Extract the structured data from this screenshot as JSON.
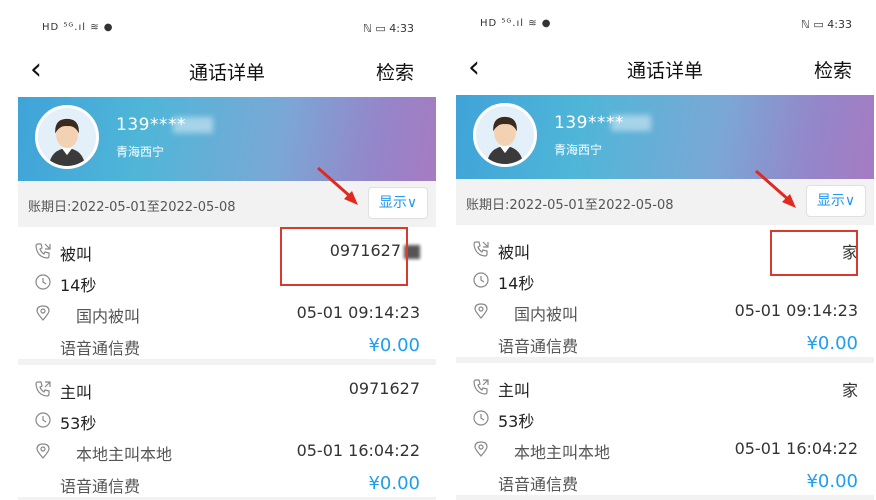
{
  "status_bar": {
    "left": "HD ⁵ᴳ.ıl ≋ ●",
    "right": "ℕ ▭ 4:33"
  },
  "nav": {
    "back_glyph": "‹",
    "title": "通话详单",
    "search": "检索"
  },
  "profile": {
    "number": "139****",
    "region": "青海西宁"
  },
  "period": {
    "label": "账期日:2022-05-01至2022-05-08",
    "show_button": "显示∨"
  },
  "left_records": [
    {
      "type": "被叫",
      "number": "0971627",
      "duration": "14秒",
      "call_kind": "国内被叫",
      "datetime": "05-01 09:14:23",
      "fee_label": "语音通信费",
      "fee": "¥0.00"
    },
    {
      "type": "主叫",
      "number": "0971627",
      "duration": "53秒",
      "call_kind": "本地主叫本地",
      "datetime": "05-01 16:04:22",
      "fee_label": "语音通信费",
      "fee": "¥0.00"
    }
  ],
  "right_records": [
    {
      "type": "被叫",
      "number": "家",
      "duration": "14秒",
      "call_kind": "国内被叫",
      "datetime": "05-01 09:14:23",
      "fee_label": "语音通信费",
      "fee": "¥0.00"
    },
    {
      "type": "主叫",
      "number": "家",
      "duration": "53秒",
      "call_kind": "本地主叫本地",
      "datetime": "05-01 16:04:22",
      "fee_label": "语音通信费",
      "fee": "¥0.00"
    }
  ],
  "icons": [
    "phone-call-icon",
    "clock-icon",
    "location-icon",
    "back-icon",
    "avatar"
  ],
  "colors": {
    "accent": "#1e9ef0",
    "highlight": "#d83b2e",
    "banner_start": "#3fa3d8",
    "banner_end": "#a67bc2"
  }
}
